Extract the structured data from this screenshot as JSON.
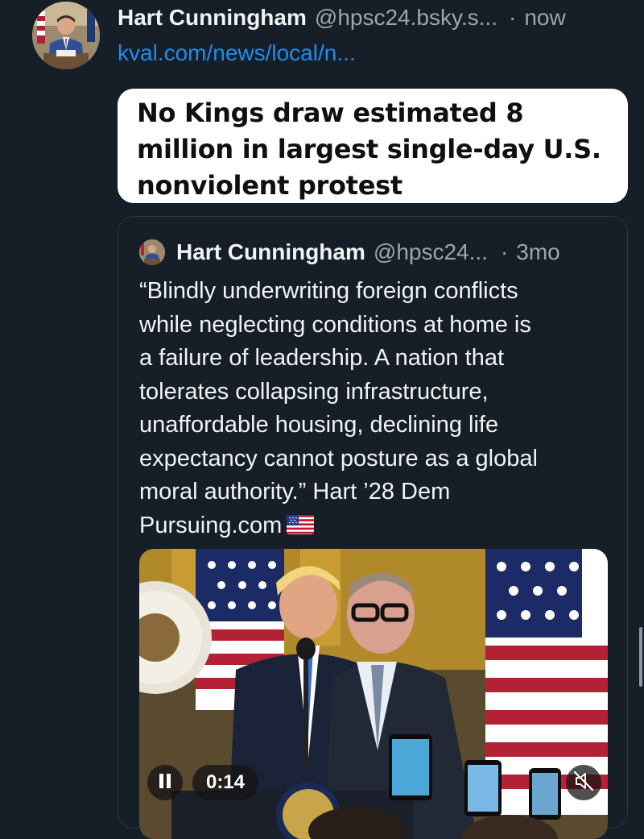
{
  "post": {
    "author_name": "Hart Cunningham",
    "handle": "@hpsc24.bsky.s...",
    "separator": "·",
    "time": "now",
    "link_text": "kval.com/news/local/n...",
    "headline": "No Kings draw estimated 8 million in largest single-day U.S. nonviolent protest"
  },
  "quoted_post": {
    "author_name": "Hart Cunningham",
    "handle": "@hpsc24...",
    "separator": "·",
    "time": "3mo",
    "text": "“Blindly underwriting foreign conflicts\nwhile neglecting conditions at home is\na failure of leadership. A nation that\ntolerates collapsing infrastructure,\nunaffordable housing, declining life\nexpectancy cannot posture as a global\nmoral authority.” Hart ’28 Dem\nPursuing.com",
    "emoji": "us-flag-emoji",
    "video": {
      "timestamp": "0:14",
      "play_state_icon": "pause-icon",
      "mute_icon": "muted-speaker-icon"
    }
  },
  "colors": {
    "background": "#161e27",
    "link": "#1d8cf0",
    "muted_text": "#9aa6b2",
    "card_border": "#2c3845"
  }
}
